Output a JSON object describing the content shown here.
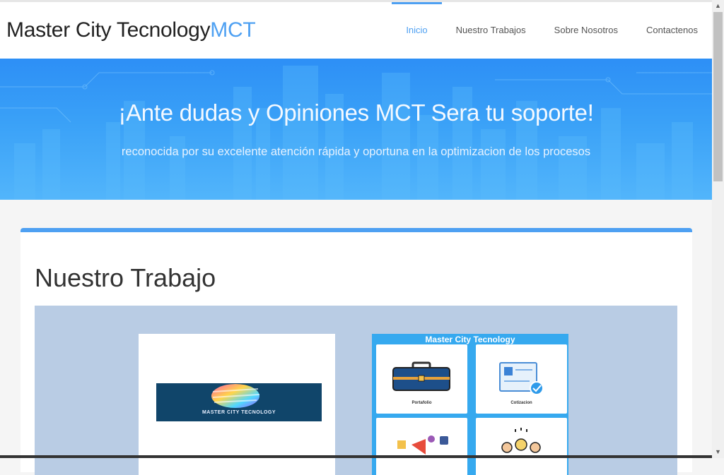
{
  "brand": {
    "name": "Master City Tecnology",
    "accent": "MCT"
  },
  "nav": {
    "items": [
      {
        "label": "Inicio",
        "active": true
      },
      {
        "label": "Nuestro Trabajos",
        "active": false
      },
      {
        "label": "Sobre Nosotros",
        "active": false
      },
      {
        "label": "Contactenos",
        "active": false
      }
    ]
  },
  "hero": {
    "title": "¡Ante dudas y Opiniones MCT Sera tu soporte!",
    "subtitle": "reconocida por su excelente atención rápida y oportuna en la optimizacion de los procesos"
  },
  "section": {
    "title": "Nuestro Trabajo",
    "thumb1_logo_text": "MASTER CITY TECNOLOGY",
    "thumb2_title": "Master City Tecnology",
    "tiles": [
      {
        "label": "Portafolio"
      },
      {
        "label": "Cotizacion"
      }
    ]
  },
  "colors": {
    "accent": "#4ea0f2",
    "hero": "#2d8ff6",
    "gallery_bg": "#b9cce4"
  },
  "icons": [
    "briefcase-icon",
    "document-check-icon",
    "media-icon",
    "people-icon"
  ]
}
